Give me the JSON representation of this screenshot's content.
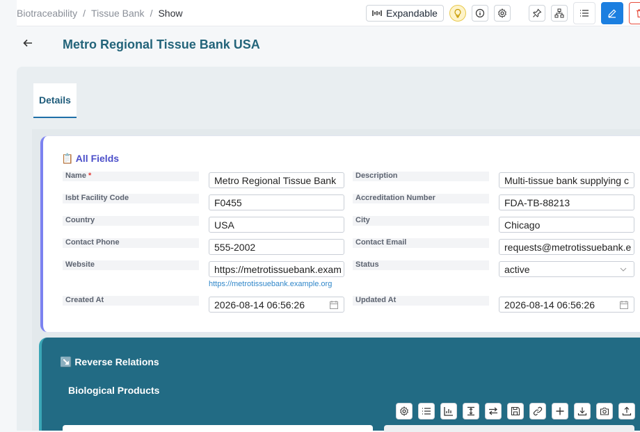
{
  "breadcrumb": [
    "Biotraceability",
    "Tissue Bank",
    "Show"
  ],
  "toolbar": {
    "expandable_label": "Expandable"
  },
  "page": {
    "title": "Metro Regional Tissue Bank USA"
  },
  "tabs": [
    {
      "label": "Details"
    }
  ],
  "all_fields": {
    "title": "📋 All Fields",
    "fields": {
      "name": {
        "label": "Name",
        "required": "*",
        "value": "Metro Regional Tissue Bank"
      },
      "description": {
        "label": "Description",
        "value": "Multi-tissue bank supplying c"
      },
      "isbt": {
        "label": "Isbt Facility Code",
        "value": "F0455"
      },
      "accreditation": {
        "label": "Accreditation Number",
        "value": "FDA-TB-88213"
      },
      "country": {
        "label": "Country",
        "value": "USA"
      },
      "city": {
        "label": "City",
        "value": "Chicago"
      },
      "phone": {
        "label": "Contact Phone",
        "value": "555-2002"
      },
      "email": {
        "label": "Contact Email",
        "value": "requests@metrotissuebank.e"
      },
      "website": {
        "label": "Website",
        "value": "https://metrotissuebank.exam",
        "link": "https://metrotissuebank.example.org"
      },
      "status": {
        "label": "Status",
        "value": "active"
      },
      "created": {
        "label": "Created At",
        "value": "2026-08-14 06:56:26"
      },
      "updated": {
        "label": "Updated At",
        "value": "2026-08-14 06:56:26"
      }
    }
  },
  "reverse": {
    "title": "↘️ Reverse Relations",
    "section": "Biological Products"
  },
  "colors": {
    "accent": "#1b7fe0",
    "title": "#23647a",
    "relations_bg": "#226b84",
    "card_border": "#7b82f0"
  }
}
